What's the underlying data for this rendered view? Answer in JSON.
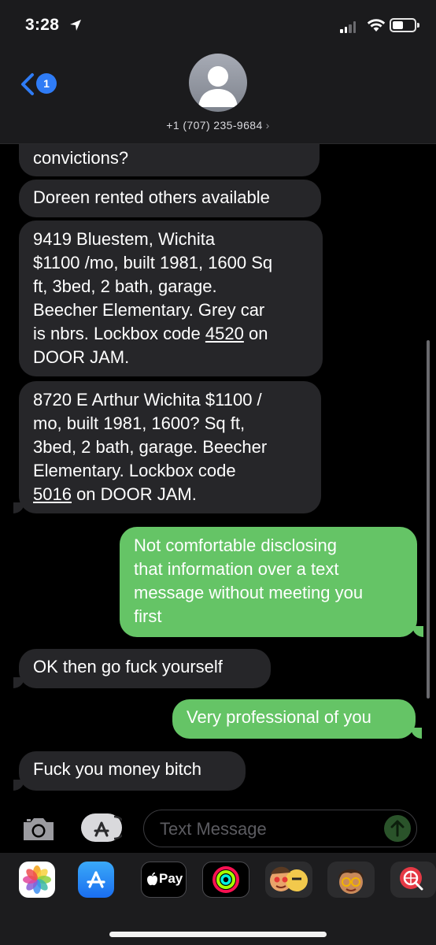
{
  "status_bar": {
    "time": "3:28"
  },
  "header": {
    "back_badge": "1",
    "contact": "+1 (707) 235-9684",
    "contact_chevron": "›"
  },
  "messages": [
    {
      "from": "them",
      "text": "convictions?"
    },
    {
      "from": "them",
      "text": "Doreen rented others available"
    },
    {
      "from": "them",
      "line1": "9419 Bluestem, Wichita",
      "line2": "$1100 /mo, built 1981, 1600 Sq",
      "line3": "ft, 3bed, 2 bath, garage.",
      "line4": "Beecher Elementary. Grey car",
      "line5_pre": "is nbrs. Lockbox code ",
      "line5_code": "4520",
      "line5_post": " on",
      "line6": "DOOR JAM."
    },
    {
      "from": "them",
      "line1": "8720 E Arthur Wichita $1100 /",
      "line2": "mo, built 1981, 1600? Sq ft,",
      "line3": "3bed, 2 bath, garage. Beecher",
      "line4": "Elementary. Lockbox code",
      "line5_code": "5016",
      "line5_post": " on DOOR JAM."
    },
    {
      "from": "me",
      "line1": "Not comfortable disclosing",
      "line2": "that information over a text",
      "line3": "message without meeting you",
      "line4": "first"
    },
    {
      "from": "them",
      "text": "OK then go fuck yourself"
    },
    {
      "from": "me",
      "text": "Very professional of you"
    },
    {
      "from": "them",
      "text": "Fuck you money bitch"
    }
  ],
  "input": {
    "placeholder": "Text Message"
  },
  "drawer": {
    "apple_pay": "Pay",
    "apps": [
      "photos-icon",
      "app-store-icon",
      "apple-pay-icon",
      "activity-icon",
      "memoji-stickers-icon",
      "memoji-icon",
      "web-search-icon"
    ]
  },
  "colors": {
    "incoming": "#262629",
    "outgoing": "#65c466",
    "accent": "#2f7cf6"
  }
}
